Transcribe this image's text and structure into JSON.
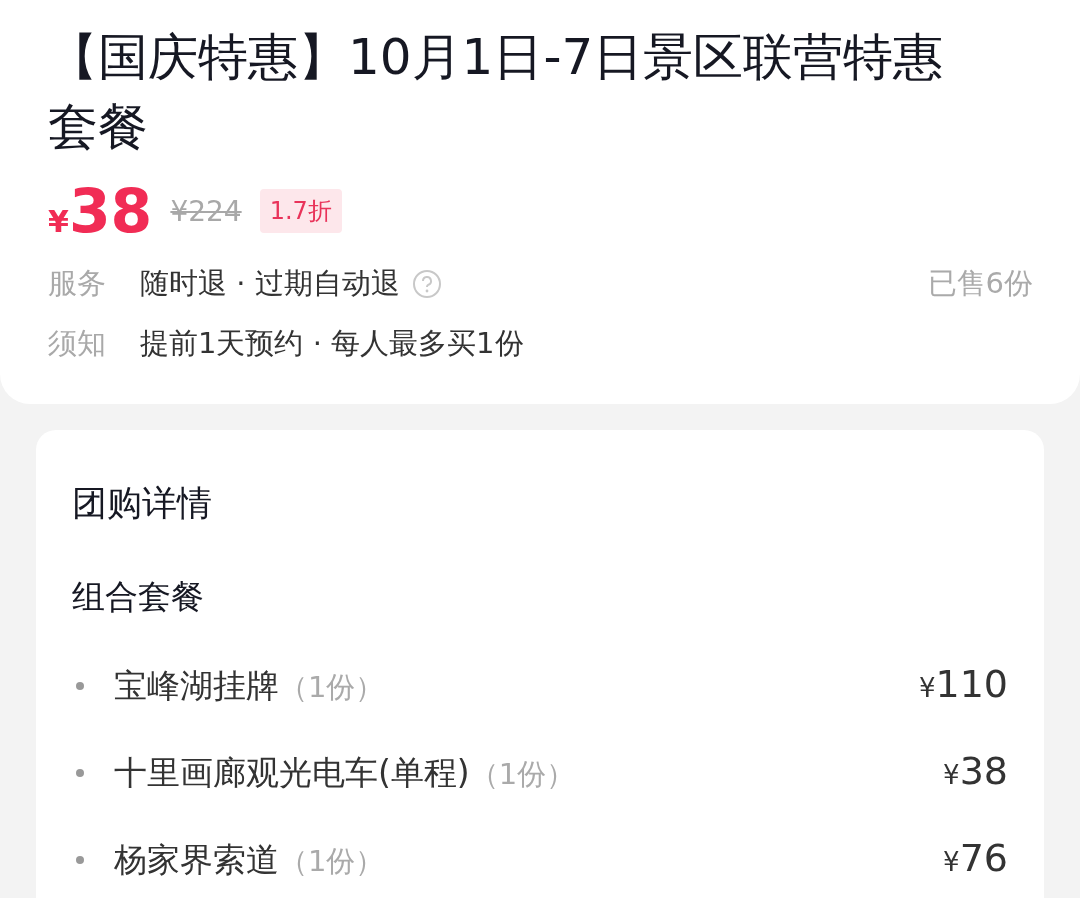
{
  "deal": {
    "title": "【国庆特惠】10月1日-7日景区联营特惠套餐",
    "price": {
      "currency": "¥",
      "amount": "38"
    },
    "original_price": "¥224",
    "discount": "1.7折",
    "info_rows": [
      {
        "label": "服务",
        "value": "随时退 · 过期自动退",
        "help": true,
        "aside": "已售6份"
      },
      {
        "label": "须知",
        "value": "提前1天预约 · 每人最多买1份",
        "help": false
      }
    ]
  },
  "details": {
    "title": "团购详情",
    "section": "组合套餐",
    "items": [
      {
        "name": "宝峰湖挂牌",
        "qty": "（1份）",
        "currency": "¥",
        "amount": "110"
      },
      {
        "name": "十里画廊观光电车(单程)",
        "qty": "（1份）",
        "currency": "¥",
        "amount": "38"
      },
      {
        "name": "杨家界索道",
        "qty": "（1份）",
        "currency": "¥",
        "amount": "76"
      }
    ]
  }
}
